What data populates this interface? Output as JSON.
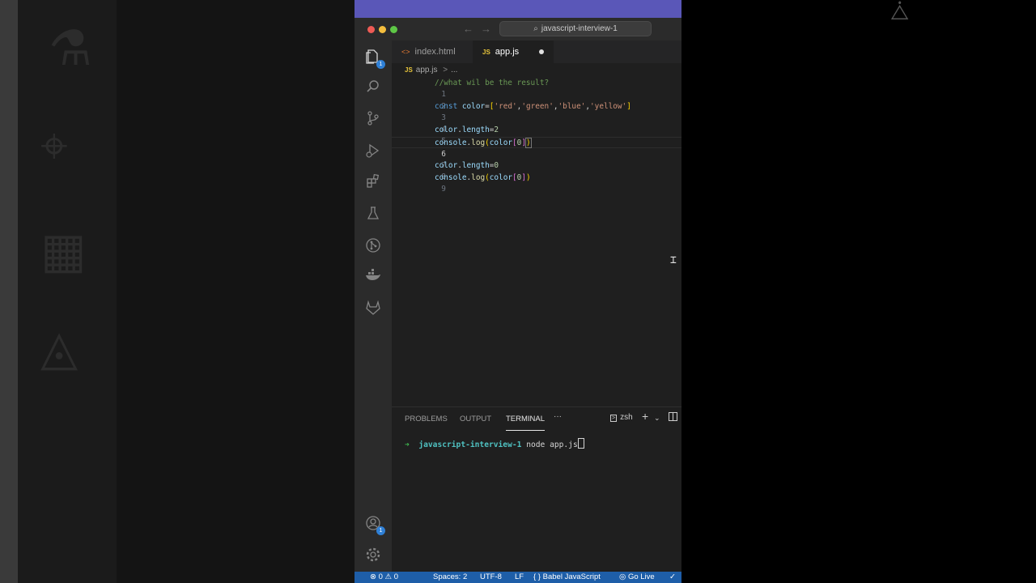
{
  "title_bar": {
    "search_text": "javascript-interview-1"
  },
  "activity_bar": {
    "explorer_badge": "1",
    "accounts_badge": "1"
  },
  "tabs": [
    {
      "label": "index.html",
      "icon_text": "<>"
    },
    {
      "label": "app.js",
      "icon_text": "JS"
    }
  ],
  "breadcrumbs": {
    "icon_text": "JS",
    "file": "app.js",
    "sep": ">",
    "more": "..."
  },
  "editor": {
    "lines": [
      {
        "n": "1",
        "text": "//what wil be the result?"
      },
      {
        "n": "2",
        "text": ""
      },
      {
        "n": "3",
        "text": "const color=['red','green','blue','yellow']"
      },
      {
        "n": "4",
        "text": ""
      },
      {
        "n": "5",
        "text": "color.length=2"
      },
      {
        "n": "6",
        "text": "console.log(color[0])"
      },
      {
        "n": "7",
        "text": ""
      },
      {
        "n": "8",
        "text": "color.length=0"
      },
      {
        "n": "9",
        "text": "console.log(color[0])"
      }
    ]
  },
  "panel": {
    "tabs": [
      "PROBLEMS",
      "OUTPUT",
      "TERMINAL"
    ],
    "more": "···",
    "shell": "zsh",
    "terminal": {
      "arrow": "➜",
      "dir": "javascript-interview-1",
      "command": "node app.js"
    }
  },
  "status_bar": {
    "errors": "0",
    "warnings": "0",
    "spaces": "Spaces: 2",
    "encoding": "UTF-8",
    "eol": "LF",
    "language": "Babel JavaScript",
    "golive": "Go Live"
  },
  "colors": {
    "comment": "#6a9955",
    "keyword": "#569cd6",
    "variable": "#9cdcfe",
    "string": "#ce9178",
    "number": "#b5cea8",
    "function": "#dcdcaa",
    "bracket": "#ffd700",
    "status_bar": "#1e5ea8",
    "brand_purple": "#5a57b8"
  }
}
